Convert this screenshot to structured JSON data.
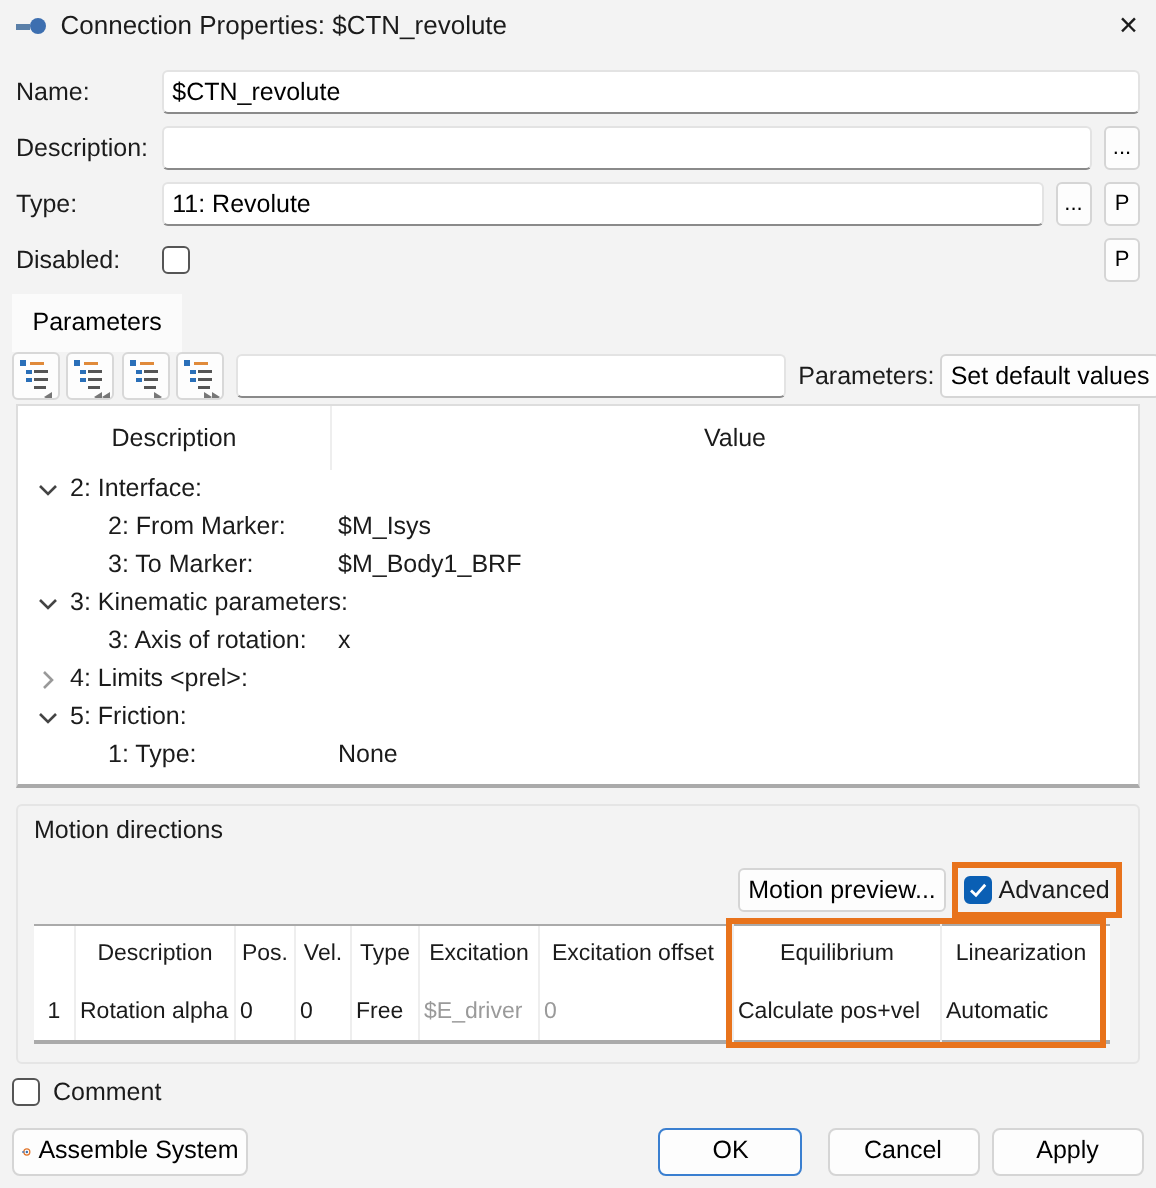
{
  "window": {
    "title": "Connection Properties: $CTN_revolute",
    "close": "✕"
  },
  "fields": [
    {
      "label": "Name:",
      "value": "$CTN_revolute",
      "kind": "text"
    },
    {
      "label": "Description:",
      "kind": "text",
      "buttons": [
        "..."
      ]
    },
    {
      "label": "Type:",
      "value": "11: Revolute",
      "kind": "text",
      "buttons": [
        "...",
        "P"
      ]
    },
    {
      "label": "Disabled:",
      "kind": "checkbox",
      "checked": false,
      "buttons": [
        "P"
      ]
    }
  ],
  "tabs": [
    {
      "label": "Parameters",
      "selected": true
    }
  ],
  "toolbar": {
    "params_label": "Parameters:",
    "default_button": "Set default values"
  },
  "tree": {
    "columns": [
      "Description",
      "Value"
    ],
    "items": [
      {
        "label": "2: Interface:",
        "expanded": true,
        "children": [
          {
            "label": "2: From Marker:",
            "value": "$M_Isys"
          },
          {
            "label": "3: To Marker:",
            "value": "$M_Body1_BRF"
          }
        ]
      },
      {
        "label": "3: Kinematic parameters:",
        "expanded": true,
        "children": [
          {
            "label": "3: Axis of rotation:",
            "value": "x"
          }
        ]
      },
      {
        "label": "4: Limits <prel>:",
        "expanded": false
      },
      {
        "label": "5: Friction:",
        "expanded": true,
        "children": [
          {
            "label": "1: Type:",
            "value": "None"
          }
        ]
      }
    ]
  },
  "motion": {
    "title": "Motion directions",
    "preview_button": "Motion preview...",
    "advanced": {
      "label": "Advanced",
      "checked": true,
      "highlighted": true
    },
    "columns": [
      {
        "highlighted": false,
        "cells": [
          {
            "text": "1",
            "dimmed": false
          }
        ]
      },
      {
        "label": "Description",
        "highlighted": false,
        "cells": [
          {
            "text": "Rotation alpha",
            "dimmed": false
          }
        ]
      },
      {
        "label": "Pos.",
        "highlighted": false,
        "cells": [
          {
            "text": "0",
            "dimmed": false
          }
        ]
      },
      {
        "label": "Vel.",
        "highlighted": false,
        "cells": [
          {
            "text": "0",
            "dimmed": false
          }
        ]
      },
      {
        "label": "Type",
        "highlighted": false,
        "cells": [
          {
            "text": "Free",
            "dimmed": false
          }
        ]
      },
      {
        "label": "Excitation",
        "highlighted": false,
        "cells": [
          {
            "text": "$E_driver",
            "dimmed": true
          }
        ]
      },
      {
        "label": "Excitation offset",
        "highlighted": false,
        "cells": [
          {
            "text": "0",
            "dimmed": true
          }
        ]
      },
      {
        "label": "Equilibrium",
        "highlighted": true,
        "cells": [
          {
            "text": "Calculate pos+vel",
            "dimmed": false
          }
        ]
      },
      {
        "label": "Linearization",
        "highlighted": true,
        "cells": [
          {
            "text": "Automatic",
            "dimmed": false
          }
        ]
      }
    ]
  },
  "comment": {
    "label": "Comment",
    "checked": false
  },
  "buttons": [
    {
      "label": "Assemble System",
      "kind": "icon",
      "default": false
    },
    {
      "label": "OK",
      "kind": "plain",
      "default": true
    },
    {
      "label": "Cancel",
      "kind": "plain",
      "default": false
    },
    {
      "label": "Apply",
      "kind": "plain",
      "default": false
    }
  ]
}
